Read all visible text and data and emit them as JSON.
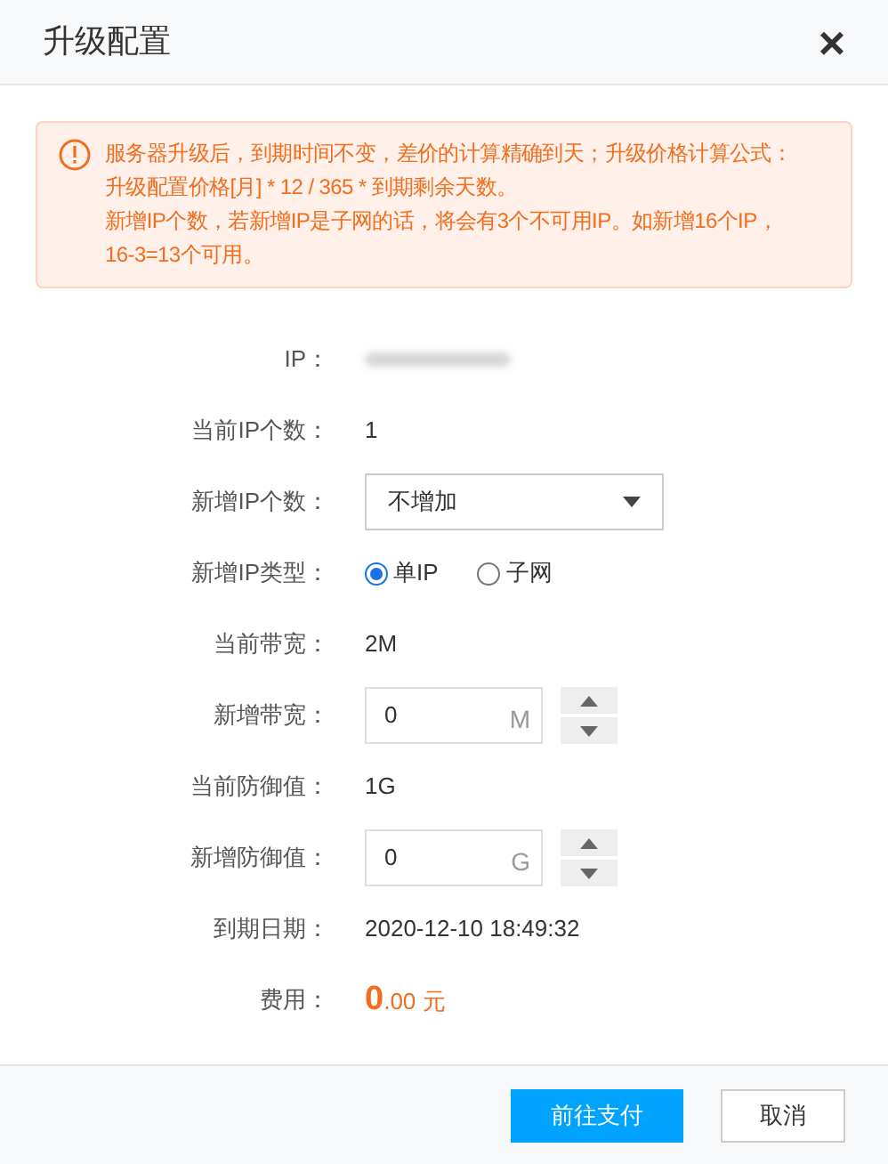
{
  "dialog": {
    "title": "升级配置",
    "close": "×"
  },
  "notice": {
    "lines": [
      "服务器升级后，到期时间不变，差价的计算精确到天；升级价格计算公式：",
      "升级配置价格[月] * 12 / 365 * 到期剩余天数。",
      "新增IP个数，若新增IP是子网的话，将会有3个不可用IP。如新增16个IP，",
      "16-3=13个可用。"
    ]
  },
  "rows": [
    {
      "kind": "redacted",
      "label": "IP："
    },
    {
      "kind": "text",
      "label": "当前IP个数：",
      "value": "1"
    },
    {
      "kind": "select",
      "label": "新增IP个数：",
      "value": "不增加"
    },
    {
      "kind": "radio",
      "label": "新增IP类型：",
      "options": [
        {
          "label": "单IP",
          "selected": true
        },
        {
          "label": "子网",
          "selected": false
        }
      ]
    },
    {
      "kind": "text",
      "label": "当前带宽：",
      "value": "2M"
    },
    {
      "kind": "number",
      "label": "新增带宽：",
      "value": "0",
      "unit": "M"
    },
    {
      "kind": "text",
      "label": "当前防御值：",
      "value": "1G"
    },
    {
      "kind": "number",
      "label": "新增防御值：",
      "value": "0",
      "unit": "G"
    },
    {
      "kind": "text",
      "label": "到期日期：",
      "value": "2020-12-10 18:49:32"
    },
    {
      "kind": "price",
      "label": "费用：",
      "integer": "0",
      "decimal": ".00",
      "currency": "元"
    }
  ],
  "buttons": [
    {
      "label": "前往支付",
      "primary": true
    },
    {
      "label": "取消",
      "primary": false
    }
  ]
}
